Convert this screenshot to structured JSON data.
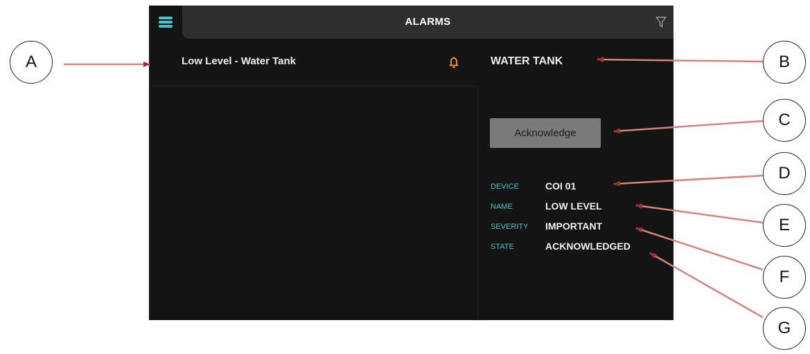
{
  "header": {
    "title": "ALARMS",
    "menu_icon": "hamburger-icon",
    "filter_icon": "filter-icon"
  },
  "alarm_list": [
    {
      "label": "Low Level - Water Tank",
      "icon": "bell-icon",
      "icon_color": "#f0a030"
    }
  ],
  "detail": {
    "title": "WATER TANK",
    "acknowledge_label": "Acknowledge",
    "properties": [
      {
        "label": "DEVICE",
        "value": "COI 01"
      },
      {
        "label": "NAME",
        "value": "LOW LEVEL"
      },
      {
        "label": "SEVERITY",
        "value": "IMPORTANT"
      },
      {
        "label": "STATE",
        "value": "ACKNOWLEDGED"
      }
    ]
  },
  "callouts": [
    "A",
    "B",
    "C",
    "D",
    "E",
    "F",
    "G"
  ],
  "colors": {
    "accent": "#4cc1c7",
    "background": "#141414",
    "title_bar": "#2e2e2e",
    "arrow": "#d98080"
  }
}
